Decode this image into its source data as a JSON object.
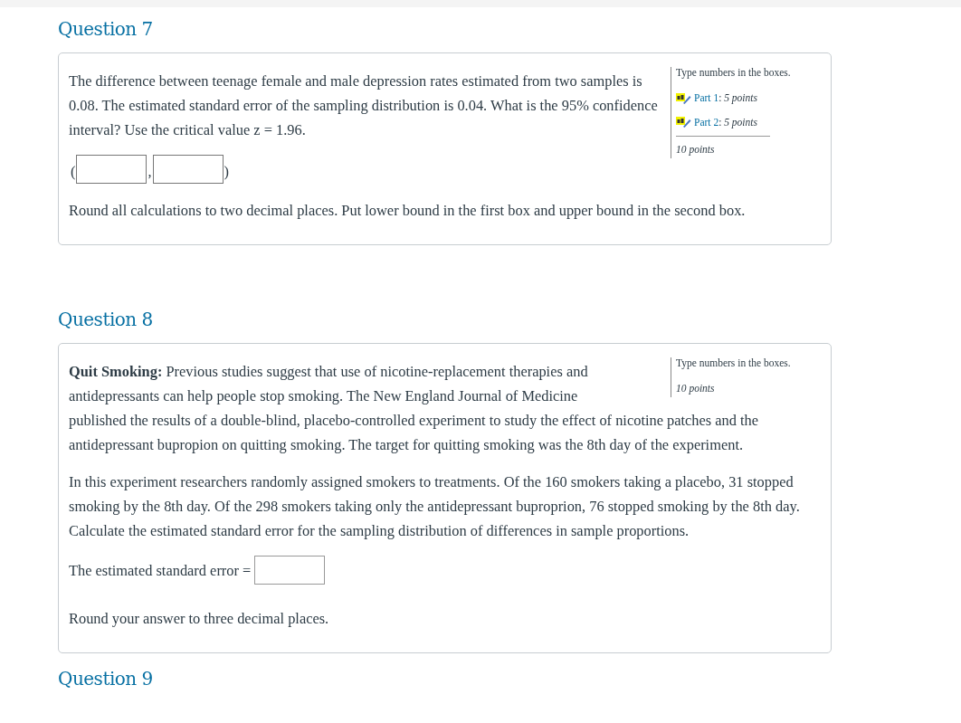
{
  "questions": [
    {
      "title": "Question 7",
      "instruction": "Type numbers in the boxes.",
      "parts": [
        {
          "label": "Part 1",
          "points": ": *5 points*"
        },
        {
          "label": "Part 2",
          "points": ": *5 points*"
        }
      ],
      "total": "10 points",
      "blocks": [
        {
          "kind": "text",
          "text": "The difference between teenage female and male depression rates estimated from two samples is 0.08. The estimated standard error of the sampling distribution is 0.04. What is the 95% confidence interval? Use the critical value z = 1.96."
        },
        {
          "kind": "interval",
          "open": "(",
          "sep": ",",
          "close": ")"
        },
        {
          "kind": "text",
          "text": "Round all calculations to two decimal places. Put lower bound in the first box and upper bound in the second box."
        }
      ]
    },
    {
      "title": "Question 8",
      "instruction": "Type numbers in the boxes.",
      "total": "10 points",
      "blocks": [
        {
          "kind": "text",
          "text": "**Quit Smoking:** Previous studies suggest that use of nicotine-replacement therapies and antidepressants can help people stop smoking. The New England Journal of Medicine"
        },
        {
          "kind": "continued",
          "text": "published the results of a double-blind, placebo-controlled experiment to study the effect of nicotine patches and the antidepressant bupropion on quitting smoking. The target for quitting smoking was the 8th day of the experiment."
        },
        {
          "kind": "text",
          "text": "In this experiment researchers randomly assigned smokers to treatments. Of the 160 smokers taking a placebo, 31 stopped smoking by the 8th day. Of the 298 smokers taking only the antidepressant buproprion, 76 stopped smoking by the 8th day. Calculate the estimated standard error for the sampling distribution of differences in sample proportions."
        },
        {
          "kind": "equation",
          "label": "The estimated standard error ="
        },
        {
          "kind": "text",
          "text": "Round your answer to three decimal places."
        }
      ]
    },
    {
      "title": "Question 9"
    }
  ]
}
